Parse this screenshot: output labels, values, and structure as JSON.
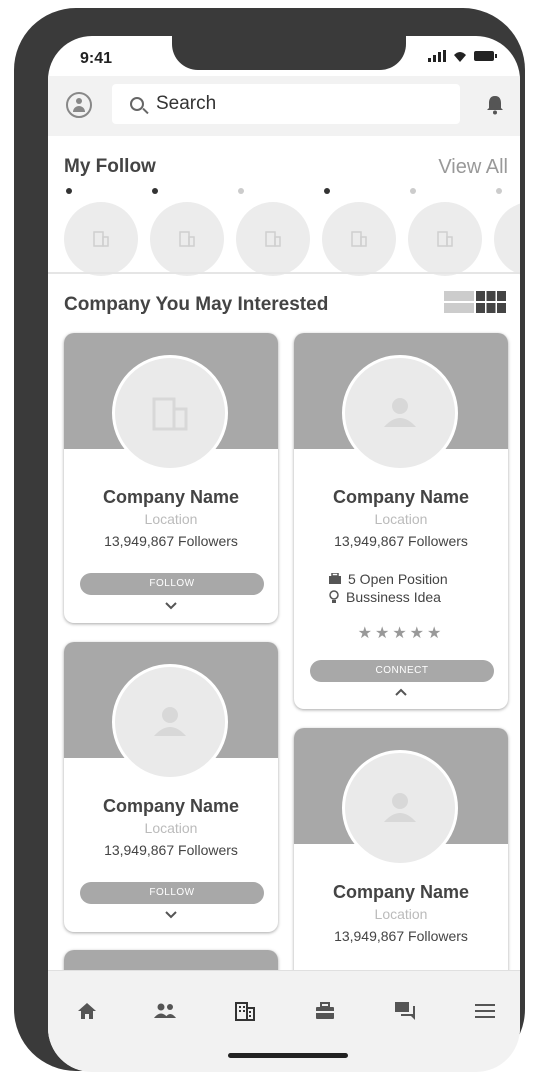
{
  "status_bar": {
    "time": "9:41"
  },
  "search": {
    "placeholder": "Search"
  },
  "my_follow": {
    "title": "My Follow",
    "view_all": "View All",
    "items": [
      {
        "dot": "dark"
      },
      {
        "dot": "dark"
      },
      {
        "dot": "light"
      },
      {
        "dot": "dark"
      },
      {
        "dot": "light"
      },
      {
        "dot": "light"
      }
    ]
  },
  "interested": {
    "title": "Company You May Interested"
  },
  "cards": [
    {
      "name": "Company Name",
      "location": "Location",
      "followers": "13,949,867 Followers",
      "button": "FOLLOW",
      "avatar": "building-icon",
      "chevron": "down"
    },
    {
      "name": "Company Name",
      "location": "Location",
      "followers": "13,949,867 Followers",
      "open_positions": "5 Open Position",
      "idea": "Bussiness Idea",
      "rating_stars": "★★★★★",
      "button": "CONNECT",
      "avatar": "person-icon",
      "chevron": "up"
    },
    {
      "name": "Company Name",
      "location": "Location",
      "followers": "13,949,867 Followers",
      "button": "FOLLOW",
      "avatar": "person-icon",
      "chevron": "down"
    },
    {
      "name": "Company Name",
      "location": "Location",
      "followers": "13,949,867 Followers",
      "avatar": "person-icon"
    }
  ],
  "bottom_nav": [
    "home-icon",
    "people-icon",
    "company-icon",
    "briefcase-icon",
    "chat-icon",
    "menu-icon"
  ],
  "colors": {
    "band": "#a8a8a8",
    "avatar_bg": "#eaeaea",
    "chrome": "#3a3a3a",
    "bar_bg": "#f2f2f2"
  }
}
